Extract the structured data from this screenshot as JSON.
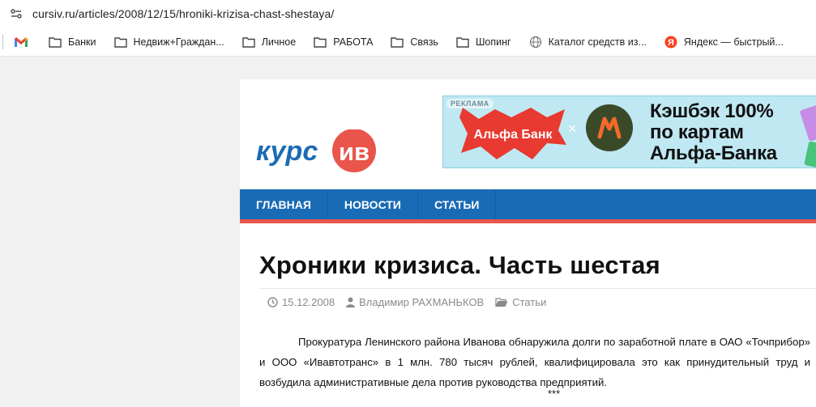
{
  "browser": {
    "url": "cursiv.ru/articles/2008/12/15/hroniki-krizisa-chast-shestaya/",
    "bookmarks": [
      {
        "label": "Банки",
        "icon": "folder-icon"
      },
      {
        "label": "Недвиж+Граждан...",
        "icon": "folder-icon"
      },
      {
        "label": "Личное",
        "icon": "folder-icon"
      },
      {
        "label": "РАБОТА",
        "icon": "folder-icon"
      },
      {
        "label": "Связь",
        "icon": "folder-icon"
      },
      {
        "label": "Шопинг",
        "icon": "folder-icon"
      },
      {
        "label": "Каталог средств из...",
        "icon": "globe-icon"
      },
      {
        "label": "Яндекс — быстрый...",
        "icon": "yandex-icon"
      }
    ]
  },
  "site": {
    "logo_text_left": "курс",
    "logo_text_right": "ив",
    "ad": {
      "label": "РЕКЛАМА",
      "bank_name": "Альфа Банк",
      "separator": "×",
      "line1": "Кэшбэк 100%",
      "line2": "по картам",
      "line3": "Альфа-Банка"
    },
    "nav": [
      "ГЛАВНАЯ",
      "НОВОСТИ",
      "СТАТЬИ"
    ],
    "article": {
      "title": "Хроники кризиса. Часть шестая",
      "date": "15.12.2008",
      "author": "Владимир РАХМАНЬКОВ",
      "category": "Статьи",
      "paragraph": "Прокуратура Ленинского района Иванова обнаружила долги по заработной плате в ОАО «Точприбор» и ООО «Ивавтотранс» в 1 млн. 780 тысяч рублей, квалифицировала это как принудительный труд и возбудила административные дела против руководства предприятий.",
      "separator": "***"
    }
  },
  "colors": {
    "nav_bg": "#1a6bb5",
    "nav_border": "#e9544b",
    "logo_blue": "#1a6bb5",
    "logo_red": "#e9544b"
  }
}
